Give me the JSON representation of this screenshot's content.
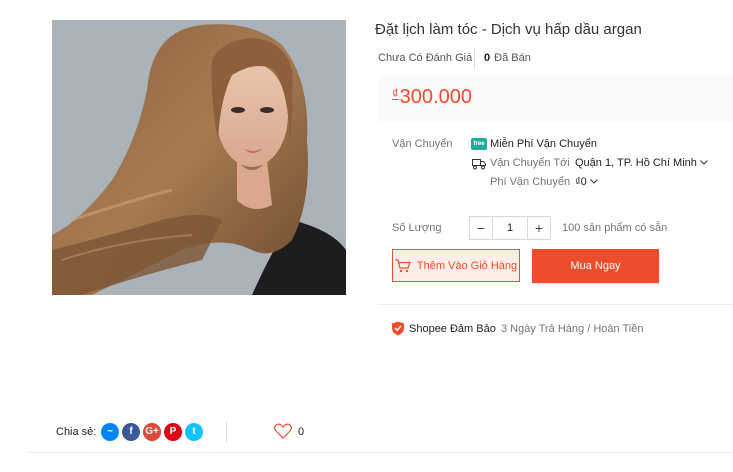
{
  "product": {
    "title": "Đặt lịch làm tóc - Dịch vụ hấp dầu argan",
    "rating_text": "Chưa Có Đánh Giá",
    "sold_count": "0",
    "sold_label": "Đã Bán",
    "currency": "₫",
    "price": "300.000",
    "image_icon": "long-hair-model-photo"
  },
  "shipping": {
    "label": "Vận Chuyển",
    "free_badge": "free",
    "free_text": "Miễn Phí Vận Chuyển",
    "ship_to_label": "Vận Chuyển Tới",
    "ship_to_value": "Quận 1, TP. Hồ Chí Minh",
    "fee_label": "Phí Vận Chuyển",
    "fee_value": "₫0"
  },
  "quantity": {
    "label": "Số Lượng",
    "minus": "−",
    "value": "1",
    "plus": "+",
    "stock": "100 sản phẩm có sẵn"
  },
  "actions": {
    "add_to_cart": "Thêm Vào Giỏ Hàng",
    "buy_now": "Mua Ngay"
  },
  "guarantee": {
    "title": "Shopee Đảm Bảo",
    "detail": "3 Ngày Trả Hàng / Hoàn Tiền"
  },
  "share": {
    "label": "Chia sẻ:",
    "networks": [
      {
        "name": "messenger-icon",
        "glyph": "~",
        "color": "#0084ff"
      },
      {
        "name": "facebook-icon",
        "glyph": "f",
        "color": "#3b5999"
      },
      {
        "name": "google-plus-icon",
        "glyph": "G+",
        "color": "#db4a39"
      },
      {
        "name": "pinterest-icon",
        "glyph": "P",
        "color": "#de0217"
      },
      {
        "name": "twitter-icon",
        "glyph": "t",
        "color": "#10c2ff"
      }
    ]
  },
  "likes": {
    "count": "0"
  },
  "colors": {
    "accent": "#ee4d2d",
    "free_ship": "#26aa99"
  }
}
